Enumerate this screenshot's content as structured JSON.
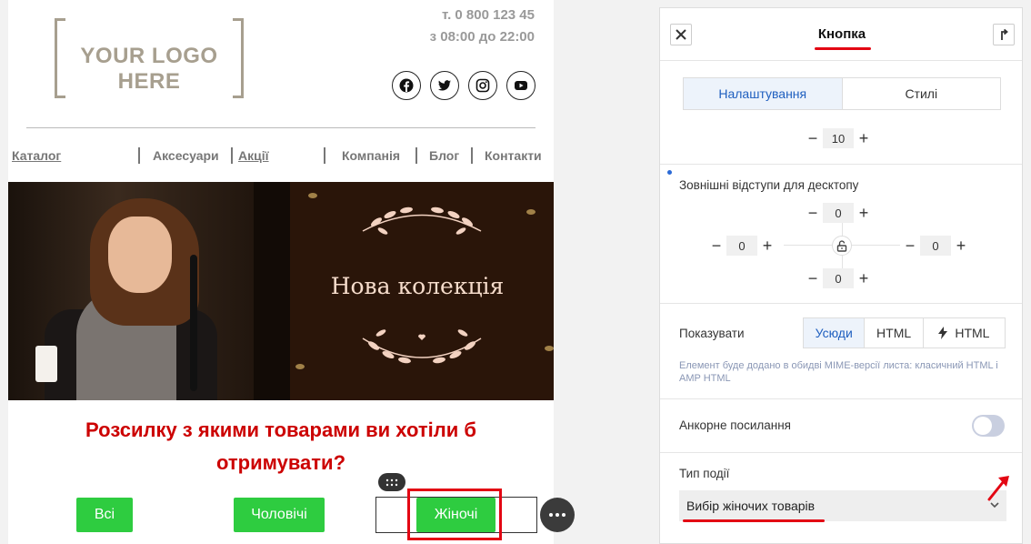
{
  "email": {
    "logo_text": "YOUR LOGO HERE",
    "phone": "т. 0 800 123 45",
    "hours": "з 08:00 до 22:00",
    "social_icons": [
      "facebook-icon",
      "twitter-icon",
      "instagram-icon",
      "youtube-icon"
    ],
    "nav": [
      "Каталог",
      "Аксесуари",
      "Акції",
      "Компанія",
      "Блог",
      "Контакти"
    ],
    "banner_title": "Нова колекція",
    "headline": "Розсилку з якими товарами ви хотіли б отримувати?",
    "buttons": [
      "Всі",
      "Чоловічі",
      "Жіночі"
    ],
    "button_color": "#2ecc40",
    "headline_color": "#cc0000"
  },
  "panel": {
    "title": "Кнопка",
    "tabs": [
      "Налаштування",
      "Стилі"
    ],
    "top_stepper_value": "10",
    "margins_label": "Зовнішні відступи для десктопу",
    "margins": {
      "top": "0",
      "left": "0",
      "right": "0",
      "bottom": "0"
    },
    "show_label": "Показувати",
    "show_options": [
      "Усюди",
      "HTML",
      "HTML"
    ],
    "show_note": "Елемент буде додано в обидві MIME-версії листа: класичний HTML і AMP HTML",
    "anchor_label": "Анкорне посилання",
    "anchor_enabled": false,
    "event_label": "Тип події",
    "event_value": "Вибір жіночих товарів",
    "accent_color": "#1f5fbf",
    "highlight_color": "#e30613"
  }
}
